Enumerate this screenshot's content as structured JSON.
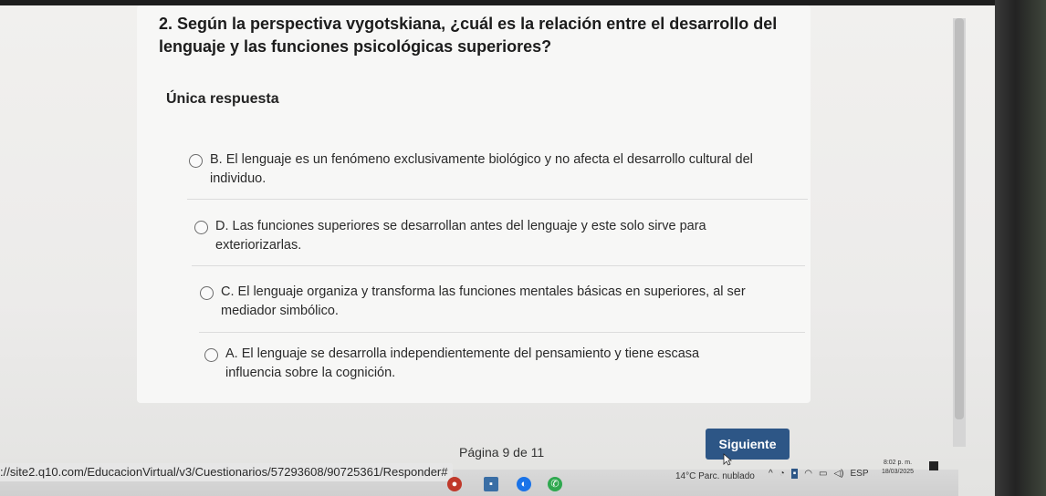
{
  "question": "2. Según la perspectiva vygotskiana, ¿cuál es la relación entre el desarrollo del lenguaje y las funciones psicológicas superiores?",
  "answer_type": "Única respuesta",
  "options": [
    {
      "text": "B. El lenguaje es un fenómeno exclusivamente biológico y no afecta el desarrollo cultural del individuo."
    },
    {
      "text": "D. Las funciones superiores se desarrollan antes del lenguaje y este solo sirve para exteriorizarlas."
    },
    {
      "text": "C. El lenguaje organiza y transforma las funciones mentales básicas en superiores, al ser mediador simbólico."
    },
    {
      "text": "A. El lenguaje se desarrolla independientemente del pensamiento y tiene escasa influencia sobre la cognición."
    }
  ],
  "page_info": "Página 9 de 11",
  "next_label": "Siguiente",
  "status_url": "://site2.q10.com/EducacionVirtual/v3/Cuestionarios/57293608/90725361/Responder#",
  "taskbar": {
    "weather": "14°C  Parc. nublado",
    "language": "ESP",
    "time": "8:02 p. m.",
    "date": "18/03/2025"
  },
  "colors": {
    "accent": "#2d5686",
    "background": "#f1f0ee"
  }
}
